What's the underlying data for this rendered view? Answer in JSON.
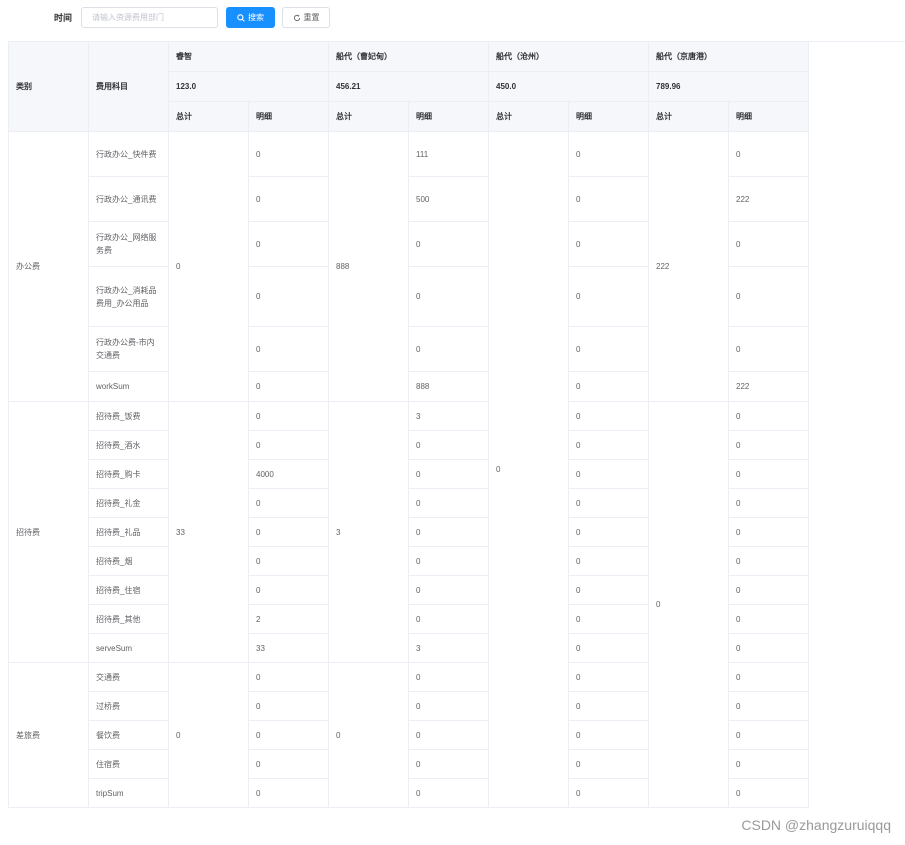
{
  "search": {
    "label": "时间",
    "placeholder": "请输入资源费用部门",
    "search_button": "搜索",
    "reset_button": "重置"
  },
  "table": {
    "header": {
      "category": "类别",
      "subject": "费用科目",
      "total": "总计",
      "detail": "明细",
      "groups": [
        {
          "name": "睿智",
          "value": "123.0"
        },
        {
          "name": "船代（曹妃甸）",
          "value": "456.21"
        },
        {
          "name": "船代（沧州）",
          "value": "450.0"
        },
        {
          "name": "船代（京唐港）",
          "value": "789.96"
        }
      ]
    },
    "sections": [
      {
        "category": "办公费",
        "totals": [
          "0",
          "888",
          "0",
          "222"
        ],
        "rows": [
          {
            "subject": "行政办公_快件费",
            "details": [
              "0",
              "111",
              "0",
              "0"
            ]
          },
          {
            "subject": "行政办公_通讯费",
            "details": [
              "0",
              "500",
              "0",
              "222"
            ]
          },
          {
            "subject": "行政办公_网络服务费",
            "details": [
              "0",
              "0",
              "0",
              "0"
            ]
          },
          {
            "subject": "行政办公_消耗品费用_办公用品",
            "details": [
              "0",
              "0",
              "0",
              "0"
            ]
          },
          {
            "subject": "行政办公费-市内交通费",
            "details": [
              "0",
              "0",
              "0",
              "0"
            ]
          },
          {
            "subject": "workSum",
            "details": [
              "0",
              "888",
              "0",
              "222"
            ]
          }
        ]
      },
      {
        "category": "招待费",
        "totals": [
          "33",
          "3",
          "0"
        ],
        "rows": [
          {
            "subject": "招待费_饭费",
            "details": [
              "0",
              "3",
              "0",
              "0"
            ]
          },
          {
            "subject": "招待费_酒水",
            "details": [
              "0",
              "0",
              "0",
              "0"
            ]
          },
          {
            "subject": "招待费_购卡",
            "details": [
              "4000",
              "0",
              "0",
              "0"
            ]
          },
          {
            "subject": "招待费_礼金",
            "details": [
              "0",
              "0",
              "0",
              "0"
            ]
          },
          {
            "subject": "招待费_礼品",
            "details": [
              "0",
              "0",
              "0",
              "0"
            ]
          },
          {
            "subject": "招待费_烟",
            "details": [
              "0",
              "0",
              "0",
              "0"
            ]
          },
          {
            "subject": "招待费_住宿",
            "details": [
              "0",
              "0",
              "0",
              "0"
            ]
          },
          {
            "subject": "招待费_其他",
            "details": [
              "2",
              "0",
              "0",
              "0"
            ]
          },
          {
            "subject": "serveSum",
            "details": [
              "33",
              "3",
              "0",
              "0"
            ]
          }
        ]
      },
      {
        "category": "差旅费",
        "totals": [
          "0",
          "0"
        ],
        "rows": [
          {
            "subject": "交通费",
            "details": [
              "0",
              "0",
              "0",
              "0"
            ]
          },
          {
            "subject": "过桥费",
            "details": [
              "0",
              "0",
              "0",
              "0"
            ]
          },
          {
            "subject": "餐饮费",
            "details": [
              "0",
              "0",
              "0",
              "0"
            ]
          },
          {
            "subject": "住宿费",
            "details": [
              "0",
              "0",
              "0",
              "0"
            ]
          },
          {
            "subject": "tripSum",
            "details": [
              "0",
              "0",
              "0",
              "0"
            ]
          }
        ]
      }
    ],
    "cangzhou_total_lower": "0",
    "jingtang_total_lower": "0"
  },
  "watermark": "CSDN @zhangzuruiqqq"
}
